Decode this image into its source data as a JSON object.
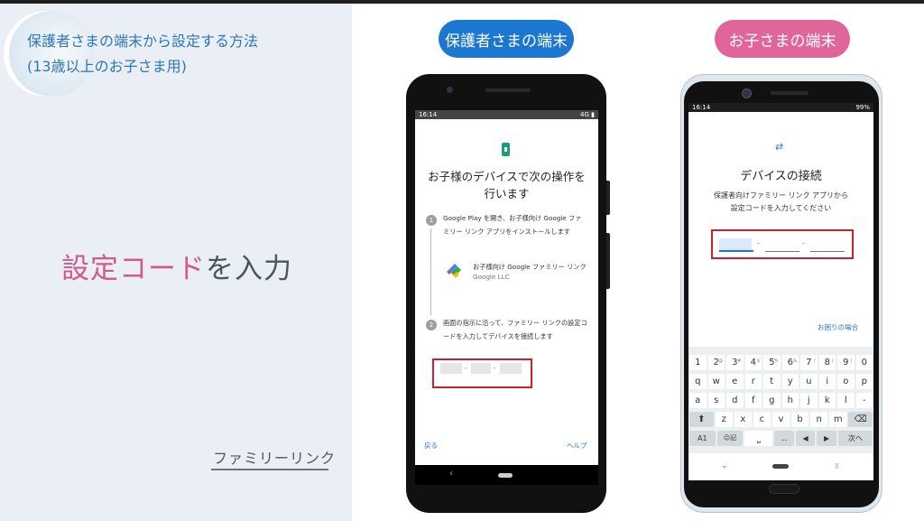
{
  "left_panel": {
    "title_line1": "保護者さまの端末から設定する方法",
    "title_line2": "(13歳以上のお子さま用)",
    "headline_highlight": "設定コード",
    "headline_rest": "を入力",
    "brand": "ファミリーリンク"
  },
  "labels": {
    "parent_device": "保護者さまの端末",
    "child_device": "お子さまの端末"
  },
  "parent_phone": {
    "status_time": "16:14",
    "status_right": "4G ▮",
    "title_line1": "お子様のデバイスで次の操作を",
    "title_line2": "行います",
    "step1_num": "1",
    "step1_text": "Google Play を開き、お子様向け Google ファミリー リンク アプリをインストールします",
    "app_name": "お子様向け Google ファミリー リンク",
    "app_publisher": "Google LLC",
    "step2_num": "2",
    "step2_text": "画面の指示に沿って、ファミリー リンクの設定コードを入力してデバイスを接続します",
    "code_sep": "-",
    "back_label": "戻る",
    "help_label": "ヘルプ",
    "nav_back": "‹"
  },
  "child_phone": {
    "status_time": "16:14",
    "status_right": "99%",
    "swap_icon": "⇄",
    "title": "デバイスの接続",
    "subtitle_line1": "保護者向けファミリー リンク アプリから",
    "subtitle_line2": "設定コードを入力してください",
    "code_sep": "-",
    "trouble_link": "お困りの場合",
    "keyboard": {
      "row1": [
        "1",
        "2",
        "3",
        "4",
        "5",
        "6",
        "7",
        "8",
        "9",
        "0"
      ],
      "row1_sup": [
        "",
        "@",
        "#",
        "$",
        "%",
        "&",
        "/",
        "(",
        ")",
        ""
      ],
      "row2": [
        "q",
        "w",
        "e",
        "r",
        "t",
        "y",
        "u",
        "i",
        "o",
        "p"
      ],
      "row3": [
        "a",
        "s",
        "d",
        "f",
        "g",
        "h",
        "j",
        "k",
        "l",
        "-"
      ],
      "row4": [
        "⬆",
        "z",
        "x",
        "c",
        "v",
        "b",
        "n",
        "m",
        "⌫"
      ],
      "row5": [
        "A1",
        "☺記",
        "⎵",
        "..",
        "◀",
        "▶",
        "次へ"
      ]
    },
    "nav_down": "⌄"
  }
}
